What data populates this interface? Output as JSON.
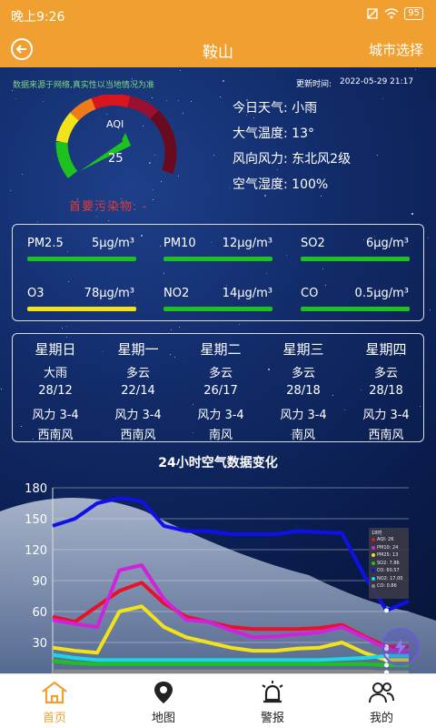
{
  "status_bar": {
    "time": "晚上9:26",
    "battery": "95"
  },
  "header": {
    "title": "鞍山",
    "right_action": "城市选择"
  },
  "source_note": "数据来源于网络,真实性以当地情况为准",
  "update_label": "更新时间:",
  "update_time": "2022-05-29 21:17",
  "aqi": {
    "label": "AQI",
    "value": 25
  },
  "primary_pollutant": "首要污染物: -",
  "weather_info": [
    {
      "label": "今日天气:",
      "value": "小雨"
    },
    {
      "label": "大气温度:",
      "value": "13°"
    },
    {
      "label": "风向风力:",
      "value": "东北风2级"
    },
    {
      "label": "空气湿度:",
      "value": "100%"
    }
  ],
  "pollutants": [
    {
      "name": "PM2.5",
      "value": "5μg/m³",
      "color": "#1ec21e"
    },
    {
      "name": "PM10",
      "value": "12μg/m³",
      "color": "#1ec21e"
    },
    {
      "name": "SO2",
      "value": "6μg/m³",
      "color": "#1ec21e"
    },
    {
      "name": "O3",
      "value": "78μg/m³",
      "color": "#f2e21a"
    },
    {
      "name": "NO2",
      "value": "14μg/m³",
      "color": "#1ec21e"
    },
    {
      "name": "CO",
      "value": "0.5μg/m³",
      "color": "#1ec21e"
    }
  ],
  "forecast": [
    {
      "day": "星期日",
      "weather": "大雨",
      "temp": "28/12",
      "wind": "风力 3-4",
      "dir": "西南风"
    },
    {
      "day": "星期一",
      "weather": "多云",
      "temp": "22/14",
      "wind": "风力 3-4",
      "dir": "西南风"
    },
    {
      "day": "星期二",
      "weather": "多云",
      "temp": "26/17",
      "wind": "风力 3-4",
      "dir": "南风"
    },
    {
      "day": "星期三",
      "weather": "多云",
      "temp": "28/18",
      "wind": "风力 3-4",
      "dir": "南风"
    },
    {
      "day": "星期四",
      "weather": "多云",
      "temp": "28/18",
      "wind": "风力 3-4",
      "dir": "西南风"
    }
  ],
  "chart_title": "24小时空气数据变化",
  "chart_data": {
    "type": "line",
    "title": "24小时空气数据变化",
    "ylim": [
      0,
      180
    ],
    "yticks": [
      30,
      60,
      90,
      120,
      150,
      180
    ],
    "grid": true,
    "series": [
      {
        "name": "AQI",
        "color": "#e8102a",
        "values": [
          55,
          50,
          65,
          80,
          88,
          68,
          55,
          50,
          45,
          43,
          43,
          43,
          44,
          47,
          36,
          26,
          26
        ]
      },
      {
        "name": "PM10",
        "color": "#d022d8",
        "values": [
          52,
          48,
          45,
          100,
          105,
          72,
          52,
          50,
          42,
          35,
          36,
          38,
          40,
          45,
          35,
          24,
          20
        ]
      },
      {
        "name": "PM25",
        "color": "#f2e21a",
        "values": [
          25,
          22,
          20,
          60,
          65,
          45,
          35,
          30,
          25,
          22,
          22,
          24,
          25,
          30,
          20,
          13,
          13
        ]
      },
      {
        "name": "SO2",
        "color": "#1ec21e",
        "values": [
          12,
          10,
          9,
          9,
          9,
          9,
          9,
          9,
          9,
          9,
          9,
          9,
          9,
          9,
          9,
          8,
          8
        ]
      },
      {
        "name": "O3",
        "color": "#1010e8",
        "values": [
          143,
          150,
          165,
          170,
          167,
          143,
          138,
          138,
          135,
          135,
          135,
          138,
          137,
          136,
          95,
          61,
          70
        ]
      },
      {
        "name": "NO2",
        "color": "#18d8e8",
        "values": [
          18,
          15,
          13,
          13,
          13,
          13,
          13,
          13,
          13,
          13,
          13,
          13,
          13,
          14,
          15,
          17,
          17
        ]
      },
      {
        "name": "CO",
        "color": "#888888",
        "values": [
          2,
          2,
          2,
          2,
          2,
          2,
          2,
          2,
          2,
          2,
          2,
          2,
          2,
          2,
          2,
          1,
          1
        ]
      }
    ],
    "tooltip": {
      "title": "18时",
      "rows": [
        "AQI: 26",
        "PM10: 24",
        "PM25: 13",
        "SO2: 7.86",
        "O3: 60.57",
        "NO2: 17.00",
        "CO: 0.86"
      ]
    }
  },
  "nav": [
    {
      "label": "首页",
      "icon": "home-icon",
      "active": true
    },
    {
      "label": "地图",
      "icon": "map-pin-icon",
      "active": false
    },
    {
      "label": "警报",
      "icon": "alarm-icon",
      "active": false
    },
    {
      "label": "我的",
      "icon": "users-icon",
      "active": false
    }
  ],
  "colors": {
    "accent": "#f0a030",
    "panel_bg": "#0b1d4a"
  }
}
